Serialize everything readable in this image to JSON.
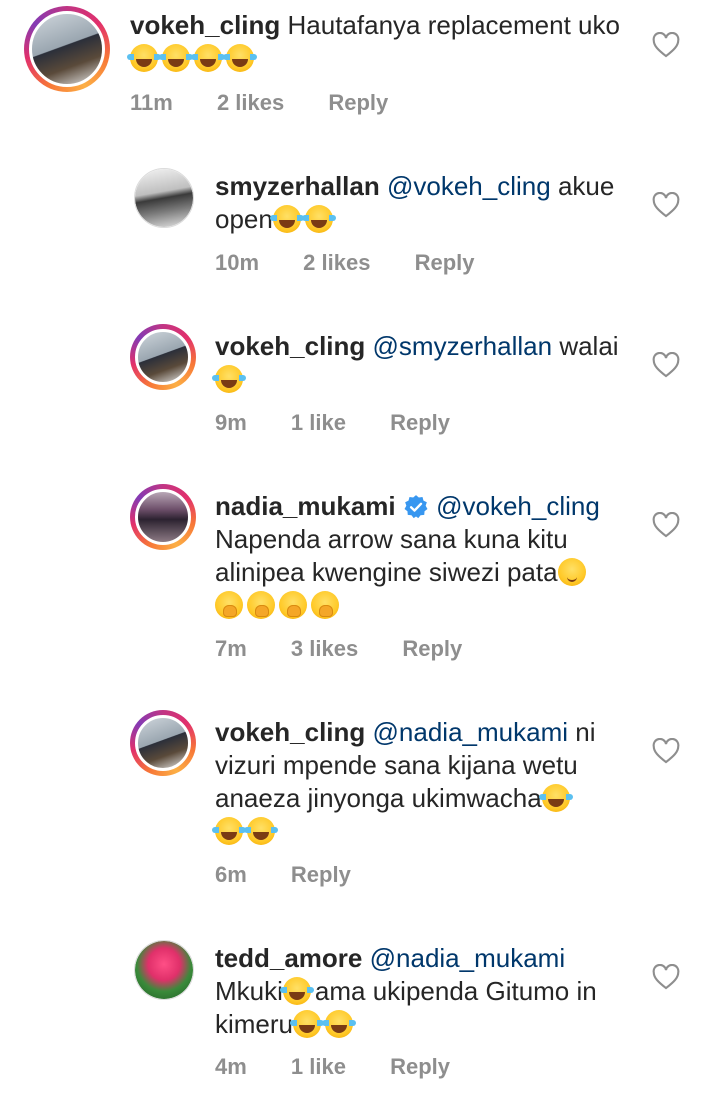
{
  "comments": [
    {
      "username": "vokeh_cling",
      "mention": "",
      "text": "Hautafanya replacement uko",
      "emojis_after": [
        "laugh",
        "laugh",
        "laugh",
        "laugh"
      ],
      "time": "11m",
      "likes": "2 likes",
      "reply": "Reply",
      "avatar": "avatar-person-ring"
    },
    {
      "username": "smyzerhallan",
      "mention": "@vokeh_cling",
      "text": "akue open",
      "emojis_after": [
        "laugh",
        "laugh"
      ],
      "time": "10m",
      "likes": "2 likes",
      "reply": "Reply",
      "avatar": "avatar-person-plain"
    },
    {
      "username": "vokeh_cling",
      "mention": "@smyzerhallan",
      "text": "walai",
      "emojis_after": [
        "laugh"
      ],
      "time": "9m",
      "likes": "1 like",
      "reply": "Reply",
      "avatar": "avatar-person-ring"
    },
    {
      "username": "nadia_mukami",
      "verified": true,
      "mention": "@vokeh_cling",
      "text": "Napenda arrow sana kuna kitu alinipea kwengine siwezi pata",
      "emojis_after": [
        "relieved"
      ],
      "emojis_line": [
        "hand",
        "hand",
        "hand",
        "hand"
      ],
      "time": "7m",
      "likes": "3 likes",
      "reply": "Reply",
      "avatar": "avatar-person-ring"
    },
    {
      "username": "vokeh_cling",
      "mention": "@nadia_mukami",
      "text": "ni vizuri mpende sana kijana wetu anaeza jinyonga ukimwacha",
      "emojis_after": [
        "laugh"
      ],
      "emojis_line": [
        "laugh",
        "laugh"
      ],
      "time": "6m",
      "likes": "",
      "reply": "Reply",
      "avatar": "avatar-person-ring"
    },
    {
      "username": "tedd_amore",
      "mention": "@nadia_mukami",
      "text_parts": [
        "Mkuki",
        "ama ukipenda Gitumo in kimeru"
      ],
      "emojis_after": [
        "laugh",
        "laugh"
      ],
      "time": "4m",
      "likes": "1 like",
      "reply": "Reply",
      "avatar": "avatar-person-plain"
    }
  ],
  "colors": {
    "mention": "#00376b",
    "meta": "#8e8e8e",
    "text": "#262626",
    "verified": "#3897f0"
  }
}
